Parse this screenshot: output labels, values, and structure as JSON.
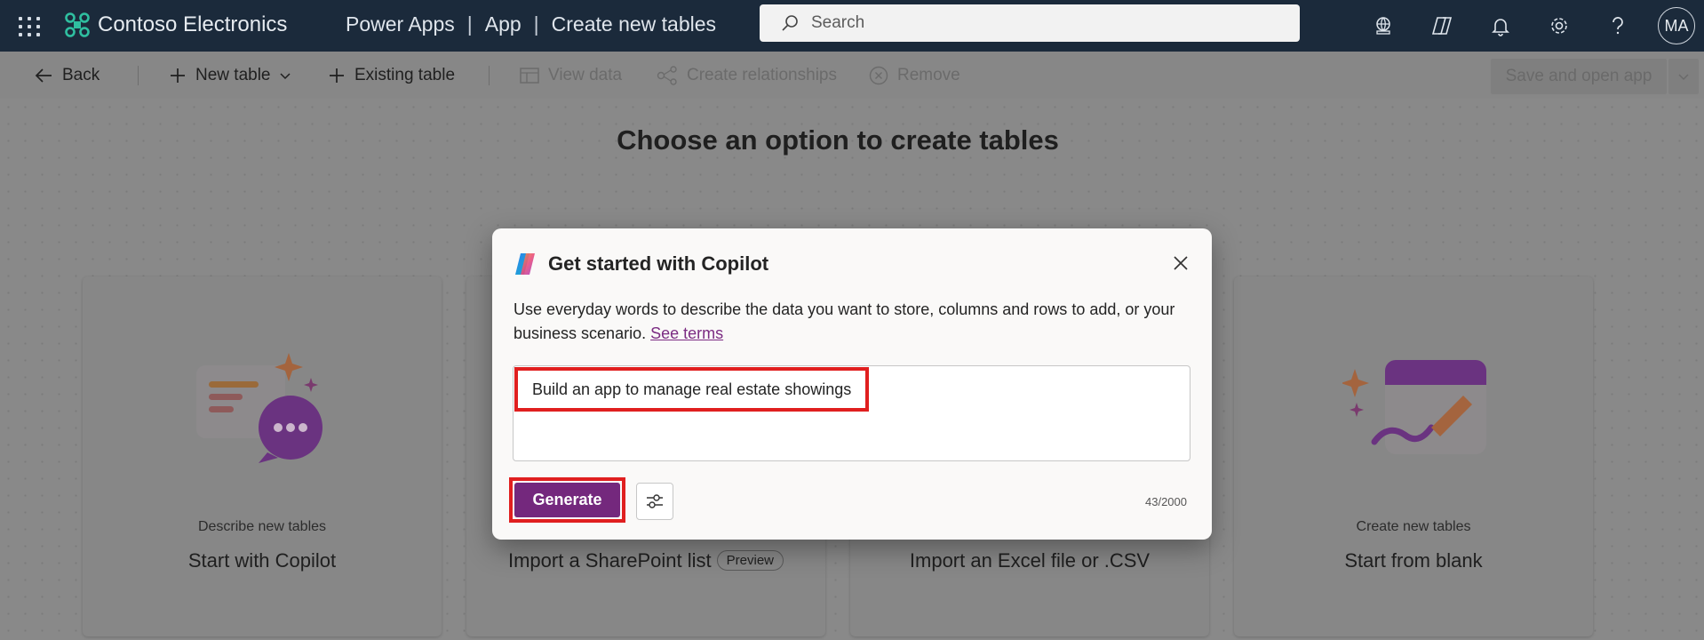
{
  "header": {
    "brand_name": "Contoso Electronics",
    "breadcrumb": [
      "Power Apps",
      "App",
      "Create new tables"
    ],
    "breadcrumb_sep": "|",
    "search_placeholder": "Search",
    "avatar_initials": "MA"
  },
  "commandbar": {
    "back": "Back",
    "new_table": "New table",
    "existing_table": "Existing table",
    "view_data": "View data",
    "create_relationships": "Create relationships",
    "remove": "Remove",
    "save_and_open": "Save and open app"
  },
  "page": {
    "heading": "Choose an option to create tables"
  },
  "cards": [
    {
      "caption": "Describe new tables",
      "title": "Start with Copilot"
    },
    {
      "caption": "",
      "title": "Import a SharePoint list",
      "badge": "Preview"
    },
    {
      "caption": "",
      "title": "Import an Excel file or .CSV"
    },
    {
      "caption": "Create new tables",
      "title": "Start from blank"
    }
  ],
  "dialog": {
    "title": "Get started with Copilot",
    "description": "Use everyday words to describe the data you want to store, columns and rows to add, or your business scenario.",
    "terms_link": "See terms",
    "prompt_value": "Build an app to manage real estate showings",
    "generate_label": "Generate",
    "counter": "43/2000"
  },
  "colors": {
    "accent": "#74287d",
    "highlight": "#e01f1f",
    "topbar": "#1b2a3b"
  }
}
